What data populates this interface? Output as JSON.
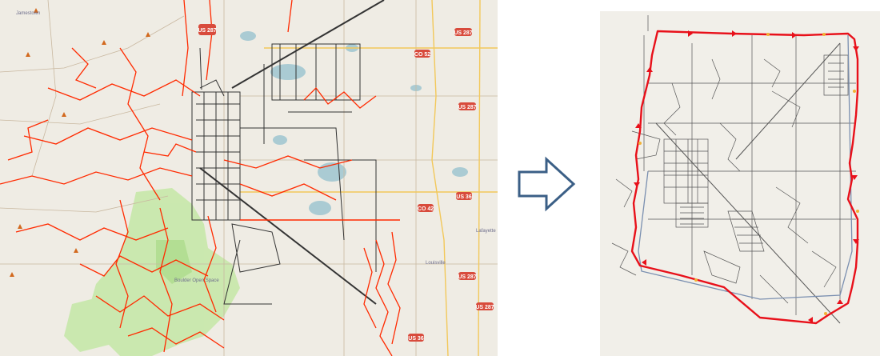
{
  "left_map": {
    "route_shields": [
      {
        "label": "US 287"
      },
      {
        "label": "US 287"
      },
      {
        "label": "CO 52"
      },
      {
        "label": "US 287"
      },
      {
        "label": "US 36"
      },
      {
        "label": "CO 42"
      },
      {
        "label": "US 287"
      },
      {
        "label": "US 287"
      },
      {
        "label": "US 36"
      }
    ],
    "place_labels": [
      {
        "label": "Jamestown"
      },
      {
        "label": "Lafayette"
      },
      {
        "label": "Louisville"
      },
      {
        "label": "Boulder Open Space"
      }
    ],
    "colors": {
      "background": "#efece4",
      "trails": "#ff2200",
      "roads": "#333333",
      "parks": "#bfe6a0",
      "water": "#b5d0d0"
    }
  },
  "right_map": {
    "colors": {
      "background": "#f1efe9",
      "boundary": "#e8101a",
      "roads": "#555555",
      "edge_line": "#7a8fb0"
    }
  },
  "transition": {
    "icon": "right-arrow-icon",
    "color": "#3b5f86"
  }
}
